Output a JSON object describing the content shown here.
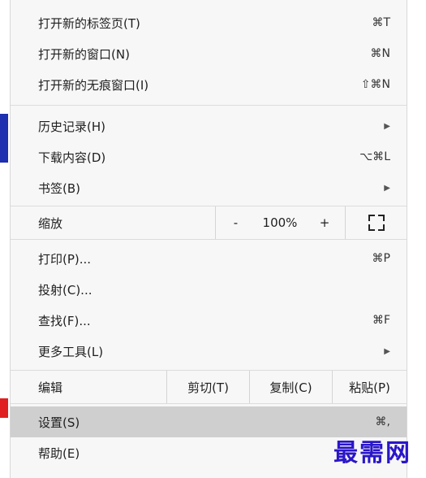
{
  "menu": {
    "new_tab": {
      "label": "打开新的标签页(T)",
      "shortcut": "⌘T"
    },
    "new_window": {
      "label": "打开新的窗口(N)",
      "shortcut": "⌘N"
    },
    "new_incognito": {
      "label": "打开新的无痕窗口(I)",
      "shortcut": "⇧⌘N"
    },
    "history": {
      "label": "历史记录(H)",
      "arrow": "▶"
    },
    "downloads": {
      "label": "下载内容(D)",
      "shortcut": "⌥⌘L"
    },
    "bookmarks": {
      "label": "书签(B)",
      "arrow": "▶"
    },
    "zoom": {
      "label": "缩放",
      "minus": "-",
      "value": "100%",
      "plus": "+"
    },
    "print": {
      "label": "打印(P)...",
      "shortcut": "⌘P"
    },
    "cast": {
      "label": "投射(C)..."
    },
    "find": {
      "label": "查找(F)...",
      "shortcut": "⌘F"
    },
    "more_tools": {
      "label": "更多工具(L)",
      "arrow": "▶"
    },
    "edit": {
      "label": "编辑",
      "cut": "剪切(T)",
      "copy": "复制(C)",
      "paste": "粘贴(P)"
    },
    "settings": {
      "label": "设置(S)",
      "shortcut": "⌘,"
    },
    "help": {
      "label": "帮助(E)"
    }
  },
  "watermark": "最需网",
  "colors": {
    "menu_bg": "#f7f7f7",
    "highlight": "#cfcfcf",
    "watermark": "#2a16c9"
  }
}
